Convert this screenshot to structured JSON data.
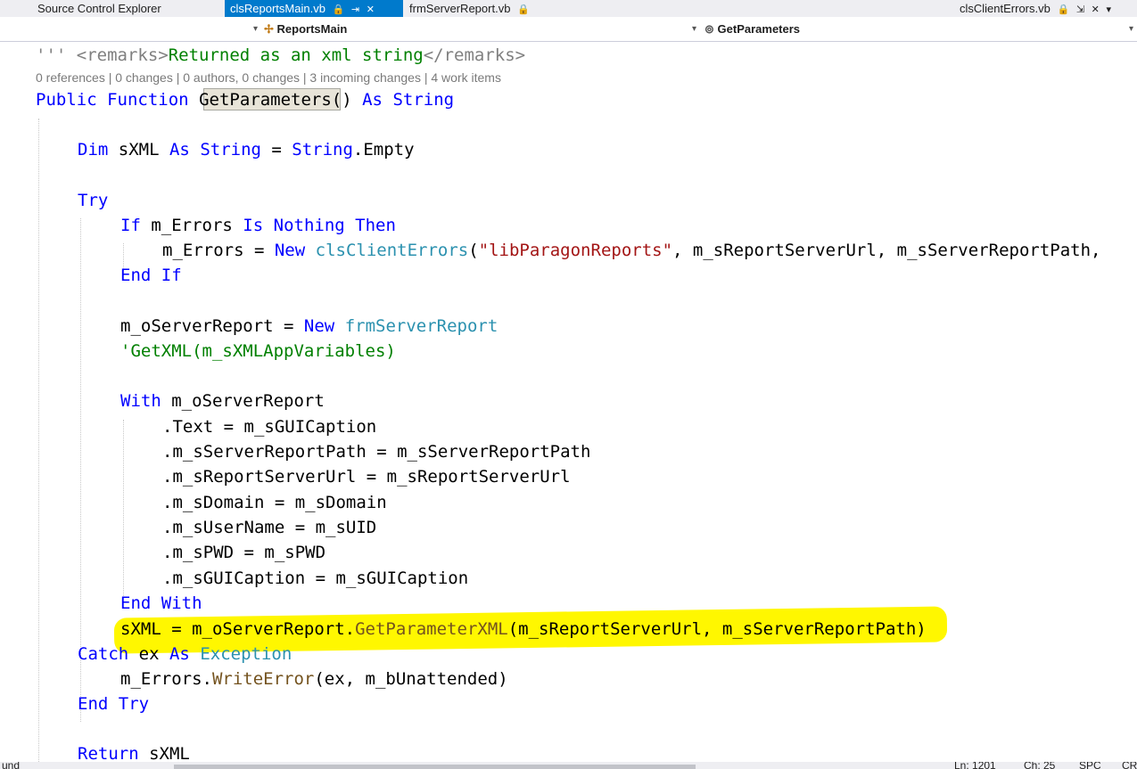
{
  "tabs": {
    "source_control_label": "Source Control Explorer",
    "active_file": "clsReportsMain.vb",
    "active_pin_icon": "lock-icon",
    "active_pin_glyph": "🔒",
    "active_keep_glyph": "⇥",
    "active_close_glyph": "✕",
    "second_file": "frmServerReport.vb",
    "second_lock_glyph": "🔒",
    "right_file": "clsClientErrors.vb",
    "right_lock_glyph": "🔒",
    "right_pin_glyph": "⇲",
    "right_close_glyph": "✕",
    "overflow_glyph": "▾"
  },
  "navbar": {
    "class_dropdown_glyph": "▾",
    "class_icon_glyph": "✢",
    "class_name": "ReportsMain",
    "member_dropdown_glyph": "▾",
    "member_icon_glyph": "⊚",
    "member_name": "GetParameters",
    "right_dropdown_glyph": "▾"
  },
  "code": {
    "remarks_prefix": "''' ",
    "remarks_open": "<remarks>",
    "remarks_text": "Returned as an xml string",
    "remarks_close": "</remarks>",
    "codelens": "0 references | 0 changes | 0 authors, 0 changes | 3 incoming changes | 4 work items",
    "l1_kw1": "Public",
    "l1_kw2": "Function",
    "l1_name": "GetParameters",
    "l1_mid": "() ",
    "l1_kw3": "As",
    "l1_kw4": "String",
    "l2_kw1": "Dim",
    "l2_var": " sXML ",
    "l2_kw2": "As",
    "l2_kw3": "String",
    "l2_eq": " = ",
    "l2_kw4": "String",
    "l2_tail": ".Empty",
    "try": "Try",
    "l3_kw1": "If",
    "l3_var": " m_Errors ",
    "l3_kw2": "Is",
    "l3_kw3": "Nothing",
    "l3_kw4": "Then",
    "l4_a": "m_Errors = ",
    "l4_kw": "New",
    "l4_type": "clsClientErrors",
    "l4_paren": "(",
    "l4_str": "\"libParagonReports\"",
    "l4_rest": ", m_sReportServerUrl, m_sServerReportPath,",
    "endif_kw1": "End",
    "endif_kw2": "If",
    "l5_a": "m_oServerReport = ",
    "l5_kw": "New",
    "l5_type": "frmServerReport",
    "l6_comment": "'GetXML(m_sXMLAppVariables)",
    "with_kw": "With",
    "with_var": " m_oServerReport",
    "w1": ".Text = m_sGUICaption",
    "w2": ".m_sServerReportPath = m_sServerReportPath",
    "w3": ".m_sReportServerUrl = m_sReportServerUrl",
    "w4": ".m_sDomain = m_sDomain",
    "w5": ".m_sUserName = m_sUID",
    "w6": ".m_sPWD = m_sPWD",
    "w7": ".m_sGUICaption = m_sGUICaption",
    "endwith_kw1": "End",
    "endwith_kw2": "With",
    "l7_a": "sXML = m_oServerReport.",
    "l7_fn": "GetParameterXML",
    "l7_rest": "(m_sReportServerUrl, m_sServerReportPath)",
    "catch_kw": "Catch",
    "catch_var": " ex ",
    "catch_kw2": "As",
    "catch_type": "Exception",
    "l8_a": "m_Errors.",
    "l8_fn": "WriteError",
    "l8_rest": "(ex, m_bUnattended)",
    "endtry_kw1": "End",
    "endtry_kw2": "Try",
    "return_kw": "Return",
    "return_var": " sXML"
  },
  "colors": {
    "highlight": "#fff700",
    "active_tab": "#007acc",
    "keyword": "#0000ff",
    "type": "#2b91af",
    "string": "#a31515",
    "comment": "#008000"
  },
  "status": {
    "left_text": "und",
    "ln": "Ln: 1201",
    "ch": "Ch: 25",
    "spc": "SPC",
    "crlf": "CR"
  }
}
